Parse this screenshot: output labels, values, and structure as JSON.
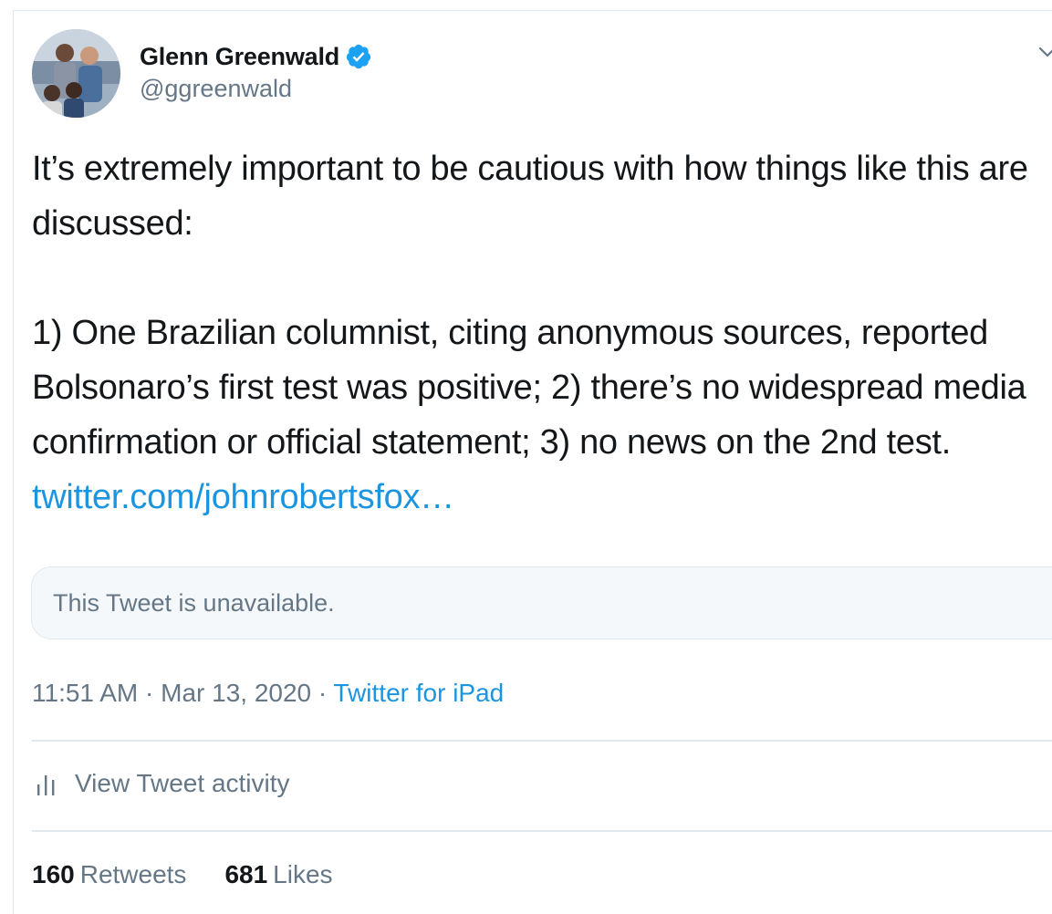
{
  "author": {
    "name": "Glenn Greenwald",
    "handle": "@ggreenwald",
    "verified": true
  },
  "tweet": {
    "intro": "It’s extremely important to be cautious with how things like this are discussed:",
    "body": "1) One Brazilian columnist, citing anonymous sources, reported Bolsonaro’s first test was positive; 2) there’s no widespread media confirmation or official statement; 3) no news on the 2nd test.",
    "link_text": "twitter.com/johnrobertsfox…"
  },
  "quoted": {
    "text": "This Tweet is unavailable."
  },
  "meta": {
    "time": "11:51 AM",
    "separator": "·",
    "date": "Mar 13, 2020",
    "source": "Twitter for iPad"
  },
  "activity": {
    "label": "View Tweet activity",
    "icon": "bars-icon"
  },
  "stats": {
    "retweets_count": "160",
    "retweets_label": "Retweets",
    "likes_count": "681",
    "likes_label": "Likes"
  },
  "colors": {
    "link": "#1b95e0",
    "text": "#14171a",
    "secondary": "#657786",
    "border": "#e1e8ed",
    "verified": "#1da1f2"
  }
}
